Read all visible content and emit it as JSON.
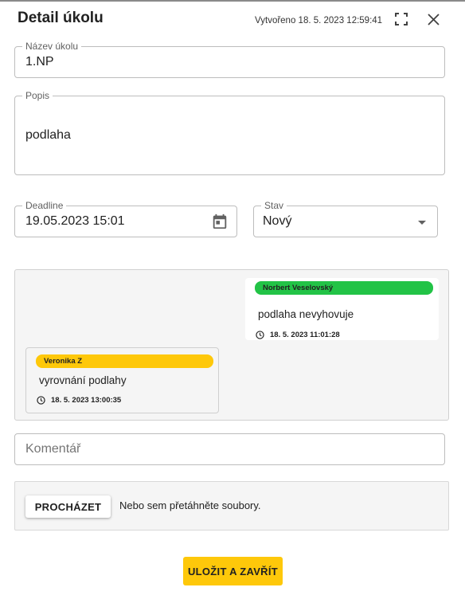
{
  "dialog": {
    "title": "Detail úkolu",
    "created": "Vytvořeno 18. 5. 2023 12:59:41"
  },
  "icons": {
    "fullscreen": "fullscreen-icon",
    "close": "close-icon",
    "calendar": "calendar-icon",
    "dropdown": "chevron-down-icon",
    "clock": "clock-icon"
  },
  "form": {
    "name": {
      "label": "Název úkolu",
      "value": "1.NP"
    },
    "description": {
      "label": "Popis",
      "value": "podlaha"
    },
    "deadline": {
      "label": "Deadline",
      "value": "19.05.2023 15:01"
    },
    "status": {
      "label": "Stav",
      "value": "Nový"
    }
  },
  "comments": [
    {
      "author": "Norbert Veselovský",
      "text": "podlaha nevyhovuje",
      "time": "18. 5. 2023 11:01:28",
      "color": "#22c346"
    },
    {
      "author": "Veronika Z",
      "text": "vyrovnání podlahy",
      "time": "18. 5. 2023 13:00:35",
      "color": "#fec80a"
    }
  ],
  "comment_input": {
    "placeholder": "Komentář"
  },
  "upload": {
    "browse_label": "PROCHÁZET",
    "drop_text": "Nebo sem přetáhněte soubory."
  },
  "actions": {
    "save_label": "ULOŽIT A ZAVŘÍT"
  },
  "colors": {
    "accent": "#fec80a",
    "success": "#22c346"
  }
}
